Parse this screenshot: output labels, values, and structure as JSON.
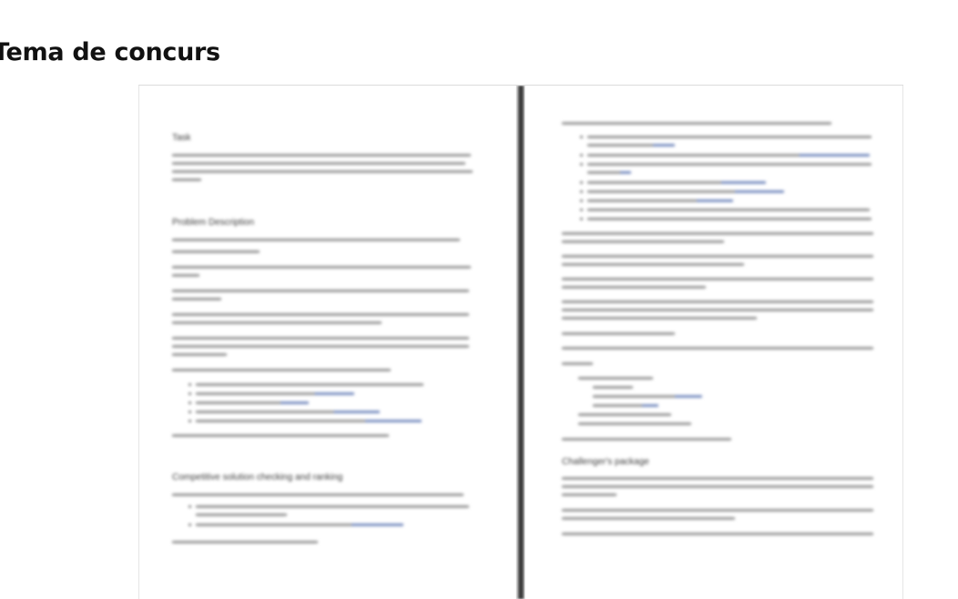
{
  "page": {
    "title": "Tema de concurs"
  },
  "document": {
    "left_page": {
      "sections": [
        "Task",
        "Problem Description",
        "Competitive solution checking and ranking"
      ]
    },
    "right_page": {
      "sections": [
        "Challenger's package"
      ]
    }
  }
}
